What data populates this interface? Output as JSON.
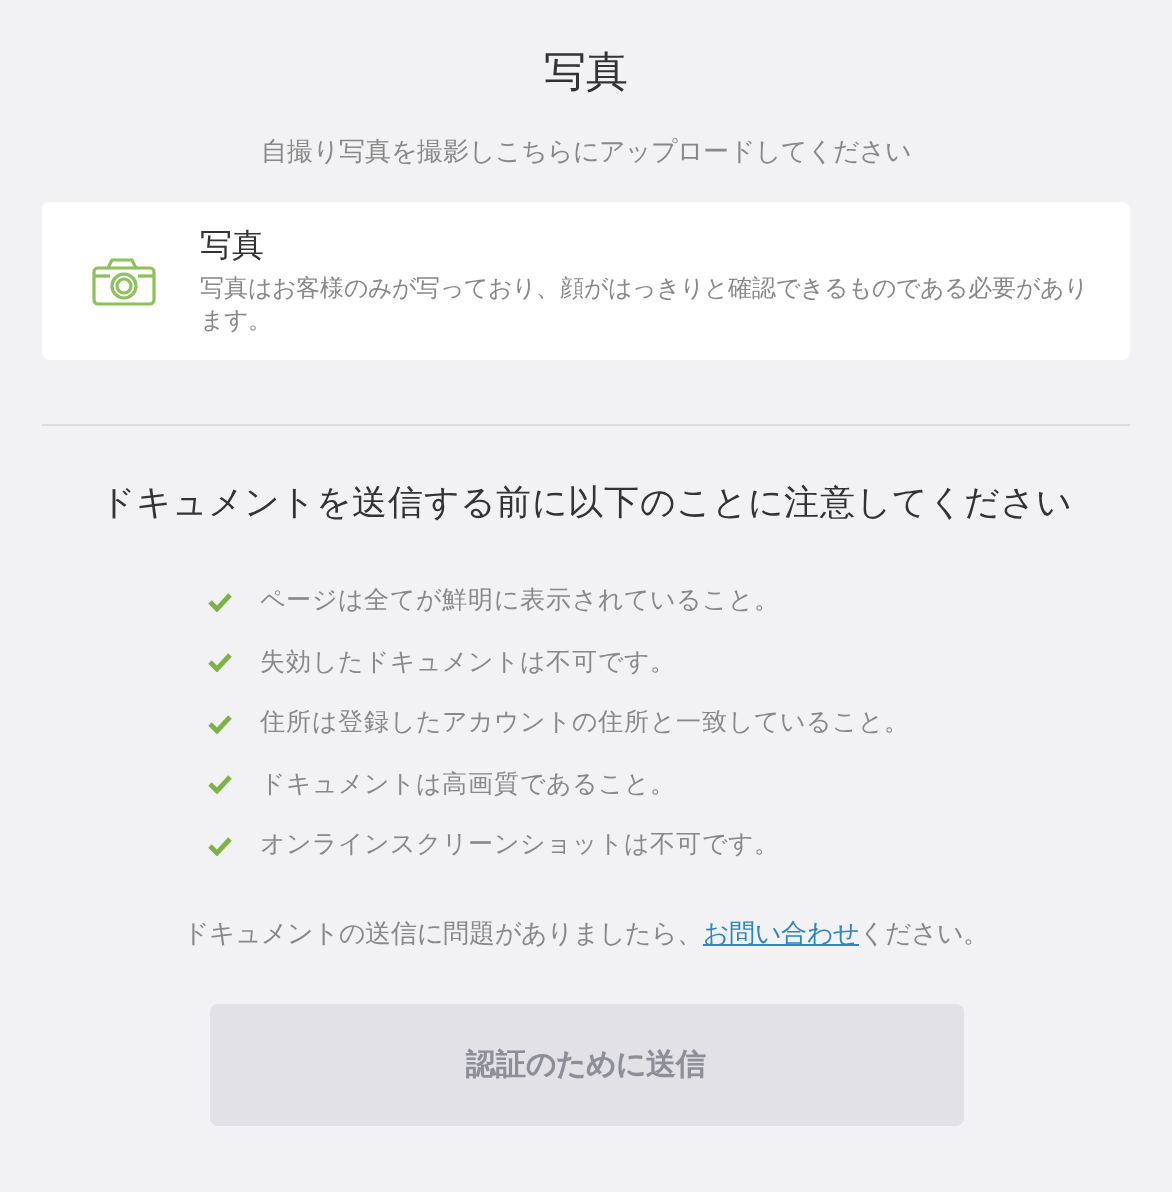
{
  "title": "写真",
  "subtitle": "自撮り写真を撮影しこちらにアップロードしてください",
  "upload_card": {
    "title": "写真",
    "description": "写真はお客様のみが写っており、顔がはっきりと確認できるものである必要があります。"
  },
  "notice": {
    "heading": "ドキュメントを送信する前に以下のことに注意してください",
    "items": [
      {
        "text": "ページは全てが鮮明に表示されていること。",
        "checked": true
      },
      {
        "text": "失効したドキュメントは不可です。",
        "checked": true
      },
      {
        "text": "住所は登録したアカウントの住所と一致していること。",
        "checked": true
      },
      {
        "text": "ドキュメントは高画質であること。",
        "checked": true
      },
      {
        "text": "オンラインスクリーンショットは不可です。",
        "checked": true
      }
    ]
  },
  "help": {
    "before": "ドキュメントの送信に問題がありましたら、",
    "link": "お問い合わせ",
    "after": "ください。"
  },
  "submit_button": {
    "label": "認証のために送信",
    "disabled": true
  }
}
